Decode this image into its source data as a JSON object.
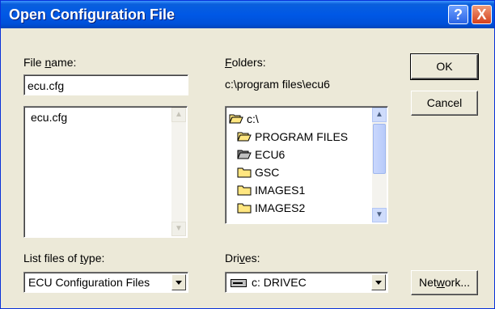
{
  "window": {
    "title": "Open Configuration File",
    "help_icon": "?",
    "close_icon": "X"
  },
  "file_name": {
    "label_pre": "File ",
    "label_key": "n",
    "label_post": "ame:",
    "value": "ecu.cfg",
    "files": [
      "ecu.cfg"
    ]
  },
  "folders": {
    "label_key": "F",
    "label_post": "olders:",
    "current_path": "c:\\program files\\ecu6",
    "items": [
      {
        "name": "c:\\",
        "icon": "open-folder-icon"
      },
      {
        "name": "PROGRAM FILES",
        "icon": "open-folder-icon"
      },
      {
        "name": "ECU6",
        "icon": "open-folder-icon"
      },
      {
        "name": "GSC",
        "icon": "closed-folder-icon"
      },
      {
        "name": "IMAGES1",
        "icon": "closed-folder-icon"
      },
      {
        "name": "IMAGES2",
        "icon": "closed-folder-icon"
      }
    ]
  },
  "file_type": {
    "label_pre": "List files of ",
    "label_key": "t",
    "label_post": "ype:",
    "selected": "ECU Configuration Files"
  },
  "drives": {
    "label_pre": "Dri",
    "label_key": "v",
    "label_post": "es:",
    "selected": "c: DRIVEC",
    "icon": "drive-icon"
  },
  "buttons": {
    "ok": "OK",
    "cancel": "Cancel",
    "network_pre": "Net",
    "network_key": "w",
    "network_post": "ork..."
  }
}
